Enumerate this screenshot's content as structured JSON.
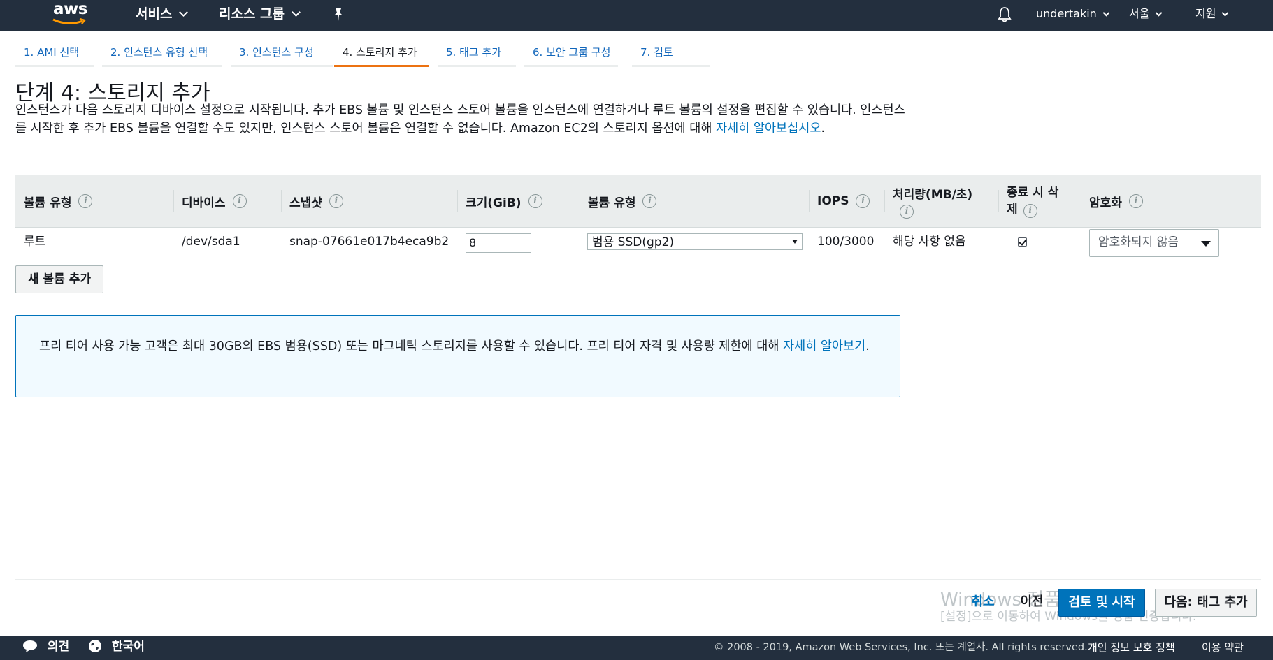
{
  "topnav": {
    "logo_text": "aws",
    "services": "서비스",
    "resource_groups": "리소스 그룹",
    "username": "undertakin",
    "region": "서울",
    "support": "지원"
  },
  "steps": [
    {
      "label": "1. AMI 선택"
    },
    {
      "label": "2. 인스턴스 유형 선택"
    },
    {
      "label": "3. 인스턴스 구성"
    },
    {
      "label": "4. 스토리지 추가",
      "active": true
    },
    {
      "label": "5. 태그 추가"
    },
    {
      "label": "6. 보안 그룹 구성"
    },
    {
      "label": "7. 검토"
    }
  ],
  "page": {
    "title": "단계 4: 스토리지 추가",
    "description": "인스턴스가 다음 스토리지 디바이스 설정으로 시작됩니다. 추가 EBS 볼륨 및 인스턴스 스토어 볼륨을 인스턴스에 연결하거나 루트 볼륨의 설정을 편집할 수 있습니다. 인스턴스를 시작한 후 추가 EBS 볼륨을 연결할 수도 있지만, 인스턴스 스토어 볼륨은 연결할 수 없습니다. Amazon EC2의 스토리지 옵션에 대해 ",
    "description_link": "자세히 알아보십시오",
    "description_end": "."
  },
  "table": {
    "headers": {
      "volume_type": "볼륨 유형",
      "device": "디바이스",
      "snapshot": "스냅샷",
      "size": "크기(GiB)",
      "volume_kind": "볼륨 유형",
      "iops": "IOPS",
      "throughput": "처리량(MB/초)",
      "delete_on_termination": "종료 시 삭제",
      "encryption": "암호화"
    },
    "row": {
      "volume_type": "루트",
      "device": "/dev/sda1",
      "snapshot": "snap-07661e017b4eca9b2",
      "size": "8",
      "volume_kind": "범용 SSD(gp2)",
      "iops": "100/3000",
      "throughput": "해당 사항 없음",
      "delete_on_termination": true,
      "encryption": "암호화되지 않음"
    },
    "info_glyph": "i"
  },
  "add_volume_button": "새 볼륨 추가",
  "infobox": {
    "text": "프리 티어 사용 가능 고객은 최대 30GB의 EBS 범용(SSD) 또는 마그네틱 스토리지를 사용할 수 있습니다. 프리 티어 자격 및 사용량 제한에 대해 ",
    "link": "자세히 알아보기",
    "end": "."
  },
  "watermark": {
    "line1": "Windows 정품 인증",
    "line2": "[설정]으로 이동하여 Windows를 정품 인증합니다."
  },
  "actions": {
    "cancel": "취소",
    "previous": "이전",
    "review_launch": "검토 및 시작",
    "next": "다음: 태그 추가"
  },
  "bottombar": {
    "feedback": "의견",
    "language": "한국어",
    "copyright": "© 2008 - 2019, Amazon Web Services, Inc. 또는 계열사. All rights reserved.",
    "privacy": "개인 정보 보호 정책",
    "terms": "이용 약관"
  }
}
